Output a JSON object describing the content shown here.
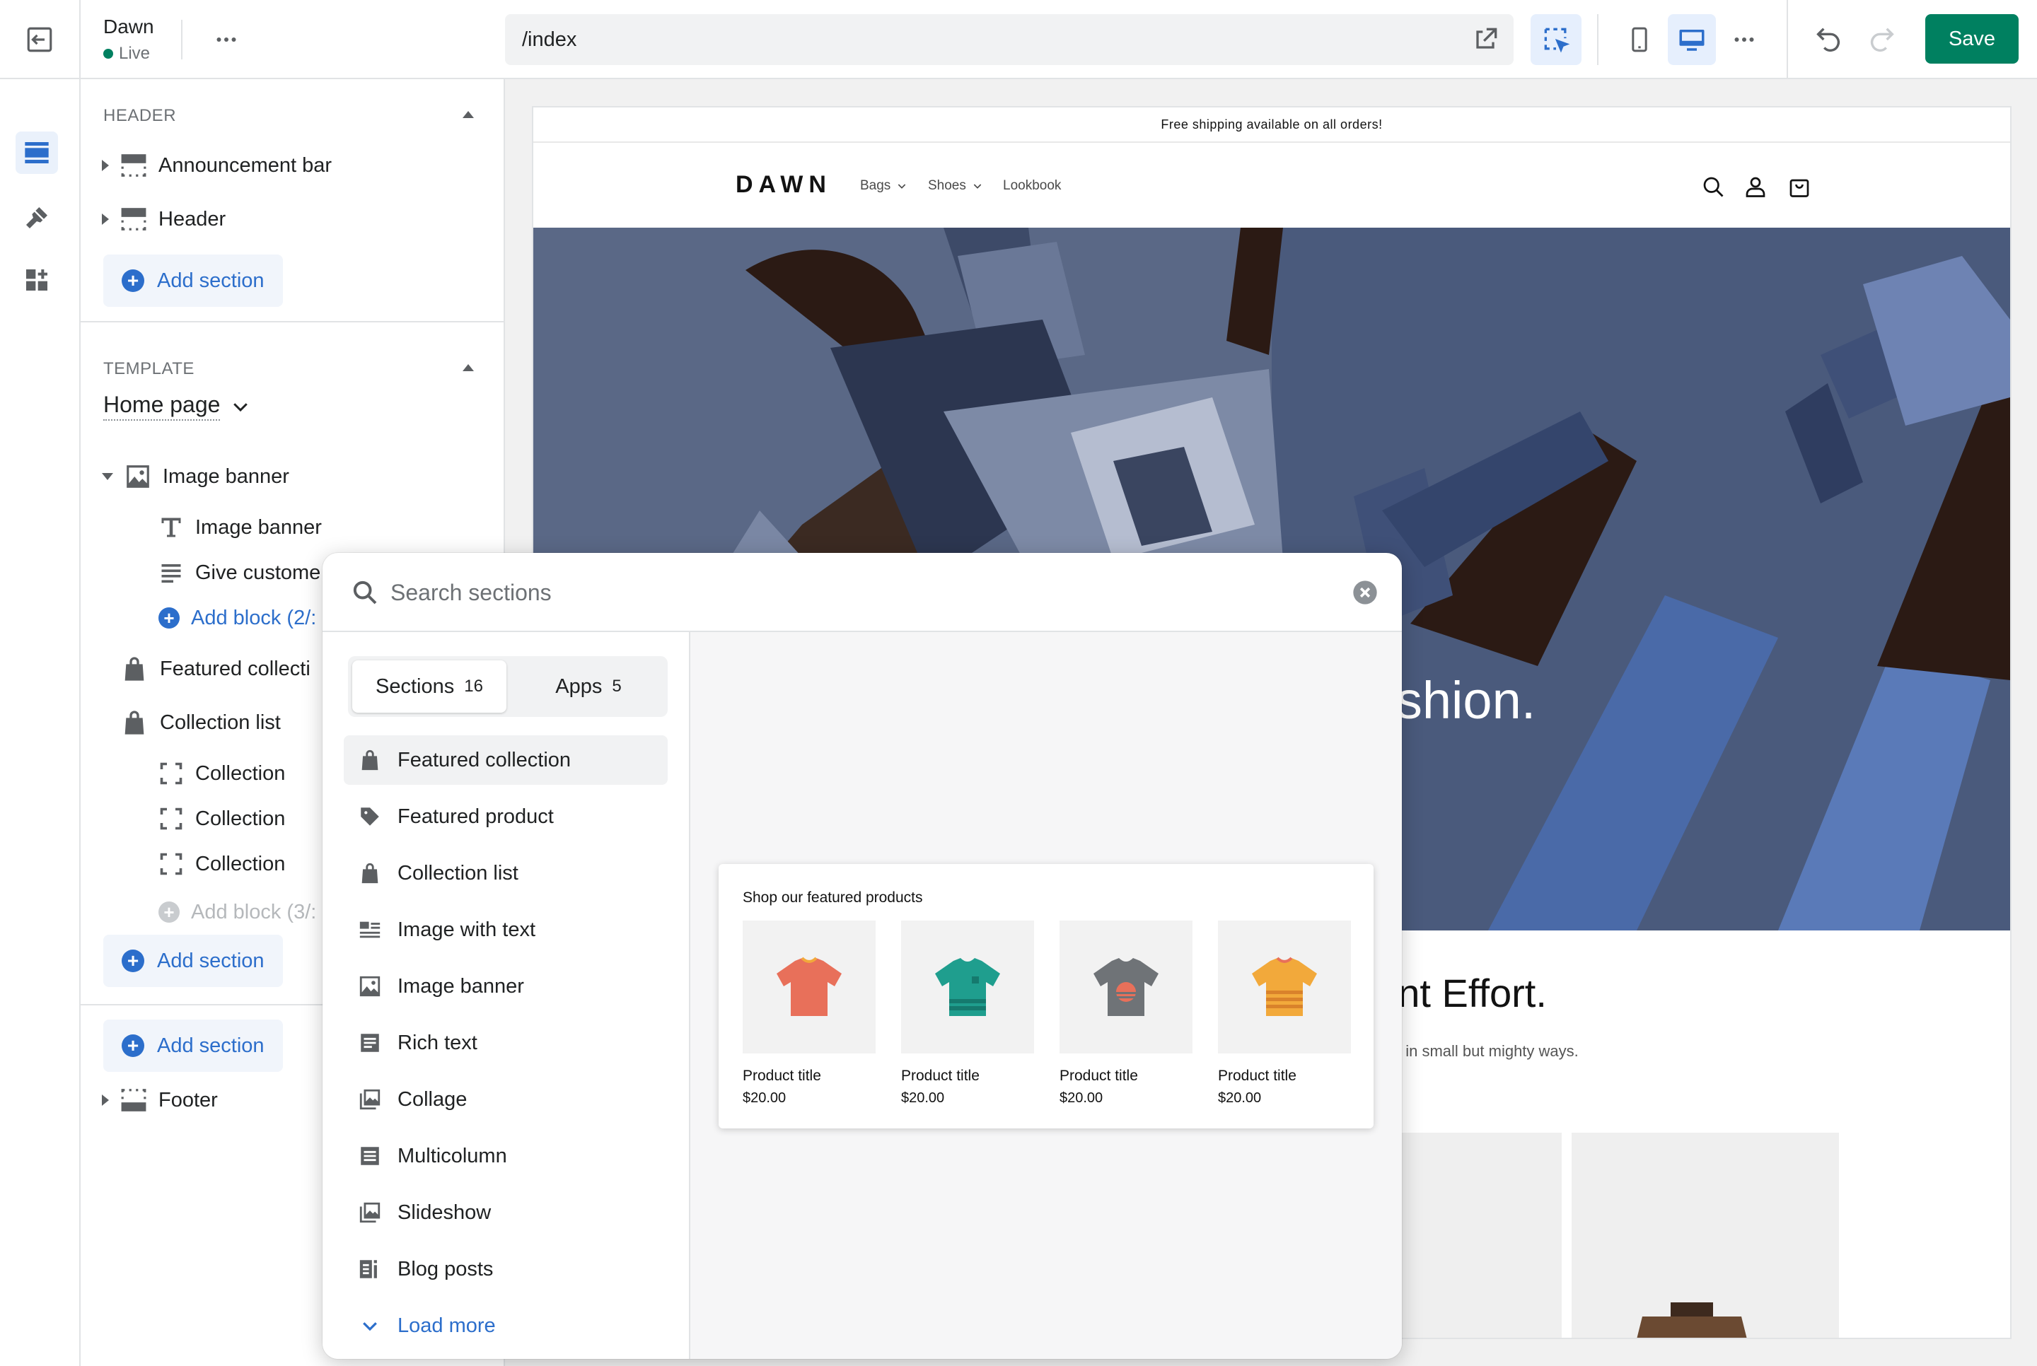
{
  "topbar": {
    "theme_name": "Dawn",
    "theme_status": "Live",
    "url": "/index",
    "save_label": "Save"
  },
  "sidebar": {
    "header_group": {
      "label": "HEADER",
      "items": [
        "Announcement bar",
        "Header"
      ],
      "add_section": "Add section"
    },
    "template_group": {
      "label": "TEMPLATE",
      "template_name": "Home page",
      "image_banner": {
        "label": "Image banner",
        "blocks": [
          "Image banner",
          "Give custome"
        ],
        "add_block": "Add block (2/:"
      },
      "featured_collection": "Featured collecti",
      "collection_list": {
        "label": "Collection list",
        "blocks": [
          "Collection",
          "Collection",
          "Collection"
        ],
        "add_block": "Add block (3/:"
      },
      "add_section": "Add section"
    },
    "footer_group": {
      "add_section": "Add section",
      "footer": "Footer"
    }
  },
  "preview": {
    "announcement": "Free shipping available on all orders!",
    "logo": "DAWN",
    "nav": [
      "Bags",
      "Shoes",
      "Lookbook"
    ],
    "hero_text": "ts fashion.",
    "heading": "gent Effort.",
    "subtext": "s lives in small but mighty ways.",
    "colors": {
      "hero_bg": "#4e5d7a",
      "skin": "#2b1a14",
      "shoe": "#3f5078"
    }
  },
  "popover": {
    "search_placeholder": "Search sections",
    "tabs": [
      {
        "label": "Sections",
        "count": "16"
      },
      {
        "label": "Apps",
        "count": "5"
      }
    ],
    "items": [
      {
        "label": "Featured collection",
        "icon": "bag-icon"
      },
      {
        "label": "Featured product",
        "icon": "tag-icon"
      },
      {
        "label": "Collection list",
        "icon": "bags-icon"
      },
      {
        "label": "Image with text",
        "icon": "image-text-icon"
      },
      {
        "label": "Image banner",
        "icon": "image-icon"
      },
      {
        "label": "Rich text",
        "icon": "text-block-icon"
      },
      {
        "label": "Collage",
        "icon": "collage-icon"
      },
      {
        "label": "Multicolumn",
        "icon": "columns-icon"
      },
      {
        "label": "Slideshow",
        "icon": "slideshow-icon"
      },
      {
        "label": "Blog posts",
        "icon": "blog-icon"
      }
    ],
    "load_more": "Load more",
    "preview_card": {
      "title": "Shop our featured products",
      "products": [
        {
          "title": "Product title",
          "price": "$20.00",
          "shirt_color": "#e8705a"
        },
        {
          "title": "Product title",
          "price": "$20.00",
          "shirt_color": "#1f9e8e"
        },
        {
          "title": "Product title",
          "price": "$20.00",
          "shirt_color": "#6f7377"
        },
        {
          "title": "Product title",
          "price": "$20.00",
          "shirt_color": "#f2a93b"
        }
      ]
    }
  },
  "colors": {
    "accent": "#2c6ecb",
    "save": "#008060",
    "live_dot": "#008060"
  }
}
